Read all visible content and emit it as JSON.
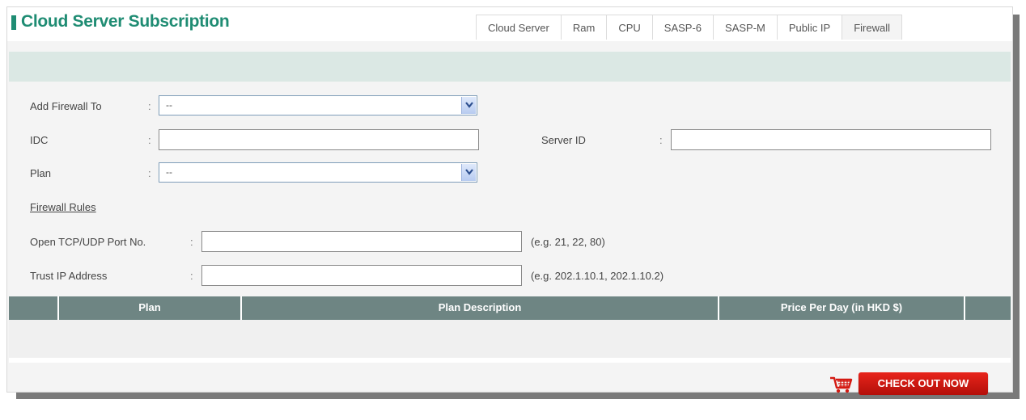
{
  "header": {
    "title": "Cloud Server Subscription",
    "accent_color": "#1f8c73"
  },
  "tabs": [
    {
      "label": "Cloud Server",
      "active": false
    },
    {
      "label": "Ram",
      "active": false
    },
    {
      "label": "CPU",
      "active": false
    },
    {
      "label": "SASP-6",
      "active": false
    },
    {
      "label": "SASP-M",
      "active": false
    },
    {
      "label": "Public IP",
      "active": false
    },
    {
      "label": "Firewall",
      "active": true
    }
  ],
  "form": {
    "colon": ":",
    "add_firewall_to": {
      "label": "Add Firewall To",
      "value": "--"
    },
    "idc": {
      "label": "IDC",
      "value": ""
    },
    "server_id": {
      "label": "Server ID",
      "value": ""
    },
    "plan": {
      "label": "Plan",
      "value": "--"
    },
    "firewall_rules_link": "Firewall Rules",
    "open_port": {
      "label": "Open TCP/UDP Port No.",
      "value": "",
      "hint": "(e.g. 21, 22, 80)"
    },
    "trust_ip": {
      "label": "Trust IP Address",
      "value": "",
      "hint": "(e.g. 202.1.10.1, 202.1.10.2)"
    }
  },
  "plan_table": {
    "headers": [
      "",
      "Plan",
      "Plan Description",
      "Price Per Day (in HKD $)",
      ""
    ],
    "header_color": "#6e8583",
    "rows": []
  },
  "checkout": {
    "label": "CHECK OUT NOW",
    "color": "#d41a12",
    "icon": "shopping-cart-icon"
  }
}
